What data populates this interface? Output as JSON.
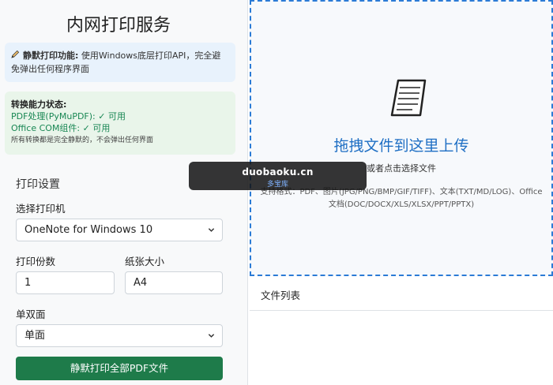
{
  "sidebar": {
    "title": "内网打印服务",
    "info": {
      "label": "静默打印功能:",
      "text": "使用Windows底层打印API，完全避免弹出任何程序界面"
    },
    "status": {
      "title": "转换能力状态:",
      "pdf": "PDF处理(PyMuPDF): ✓ 可用",
      "office": "Office COM组件: ✓ 可用",
      "note": "所有转换都是完全静默的，不会弹出任何界面"
    },
    "settings": {
      "section_title": "打印设置",
      "printer_label": "选择打印机",
      "printer_value": "OneNote for Windows 10",
      "copies_label": "打印份数",
      "copies_value": "1",
      "paper_label": "纸张大小",
      "paper_value": "A4",
      "duplex_label": "单双面",
      "duplex_value": "单面",
      "print_button": "静默打印全部PDF文件"
    }
  },
  "dropzone": {
    "title": "拖拽文件到这里上传",
    "subtitle": "或者点击选择文件",
    "formats": "支持格式：PDF、图片(JPG/PNG/BMP/GIF/TIFF)、文本(TXT/MD/LOG)、Office文档(DOC/DOCX/XLS/XLSX/PPT/PPTX)"
  },
  "file_list": {
    "header": "文件列表"
  },
  "watermark": {
    "main": "duobaoku.cn",
    "sub": "多宝库"
  },
  "colors": {
    "accent_blue": "#1f6fc4",
    "button_green": "#1e7b4a",
    "status_green": "#198754"
  }
}
